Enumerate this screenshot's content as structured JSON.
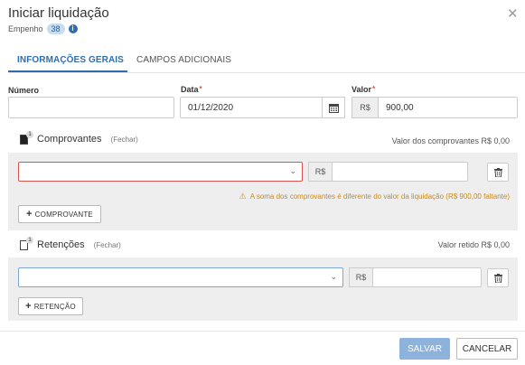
{
  "dialog": {
    "title": "Iniciar liquidação",
    "close_label": "✕",
    "subtitle_label": "Empenho",
    "subtitle_badge": "38",
    "info_icon": "info-icon"
  },
  "tabs": [
    {
      "label": "INFORMAÇÕES GERAIS",
      "active": true
    },
    {
      "label": "CAMPOS ADICIONAIS",
      "active": false
    }
  ],
  "form": {
    "numero": {
      "label": "Número",
      "value": ""
    },
    "data": {
      "label": "Data",
      "required": "*",
      "value": "01/12/2020",
      "icon": "calendar-icon"
    },
    "valor": {
      "label": "Valor",
      "required": "*",
      "currency": "R$",
      "value": "900,00"
    }
  },
  "comprovantes": {
    "badge": "1",
    "title": "Comprovantes",
    "toggle": "(Fechar)",
    "summary": "Valor dos comprovantes R$ 0,00",
    "select_value": "",
    "currency": "R$",
    "amount_value": "",
    "warning": "A soma dos comprovantes é diferente do valor da liquidação (R$ 900,00 faltante)",
    "add_button": "COMPROVANTE"
  },
  "retencoes": {
    "badge": "1",
    "title": "Retenções",
    "toggle": "(Fechar)",
    "summary": "Valor retido R$ 0,00",
    "select_value": "",
    "currency": "R$",
    "amount_value": "",
    "add_button": "RETENÇÃO"
  },
  "footer": {
    "save": "SALVAR",
    "cancel": "CANCELAR"
  },
  "colors": {
    "accent": "#2f6eae",
    "error": "#d9534f",
    "warning": "#c98a1a",
    "primary_disabled": "#8db2db"
  }
}
